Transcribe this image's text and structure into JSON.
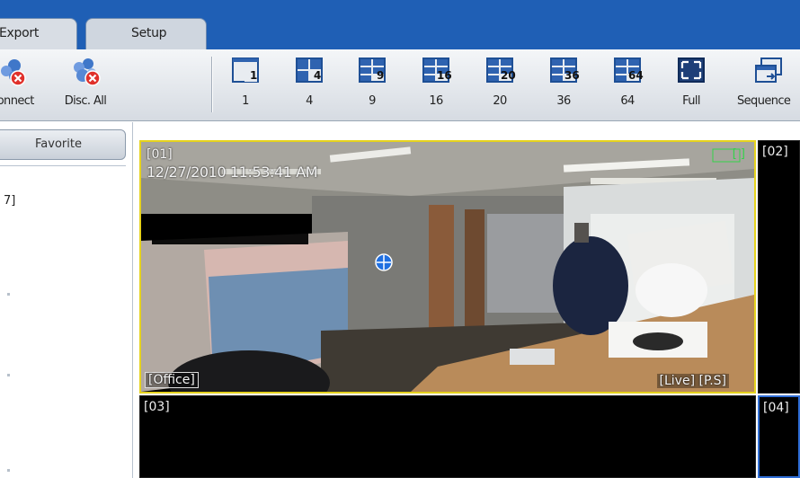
{
  "tabs": [
    {
      "label": "Export"
    },
    {
      "label": "Setup"
    }
  ],
  "toolbar": {
    "connect_label": "Connect",
    "disconnect_all_label": "Disc. All",
    "layouts": [
      {
        "label": "1",
        "badge": "1"
      },
      {
        "label": "4",
        "badge": "4"
      },
      {
        "label": "9",
        "badge": "9"
      },
      {
        "label": "16",
        "badge": "16"
      },
      {
        "label": "20",
        "badge": "20"
      },
      {
        "label": "36",
        "badge": "36"
      },
      {
        "label": "64",
        "badge": "64"
      }
    ],
    "full_label": "Full",
    "sequence_label": "Sequence"
  },
  "left_panel": {
    "header": "Favorite",
    "item": "7]"
  },
  "cameras": {
    "cell1": {
      "index": "[01]",
      "timestamp": "12/27/2010 11:53:41 AM",
      "name": "[Office]",
      "status": "[Live] [P.S]",
      "rec_indicator": "[ ]"
    },
    "cell2": {
      "index": "[02]"
    },
    "cell3": {
      "index": "[03]"
    },
    "cell4": {
      "index": "[04]"
    }
  },
  "colors": {
    "tab_bar": "#1f5fb5",
    "selected_cell_border": "#e6d31e",
    "focus_cell_border": "#2f6ed6"
  }
}
